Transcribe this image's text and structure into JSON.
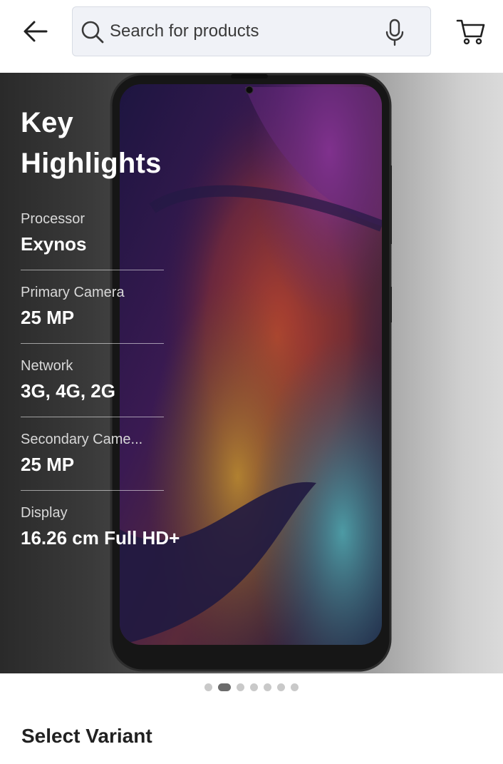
{
  "header": {
    "search_placeholder": "Search for products",
    "icons": [
      "back-arrow-icon",
      "search-icon",
      "mic-icon",
      "cart-icon"
    ]
  },
  "hero": {
    "title_line1": "Key",
    "title_line2": "Highlights",
    "highlights": [
      {
        "label": "Processor",
        "value": "Exynos"
      },
      {
        "label": "Primary Camera",
        "value": "25 MP"
      },
      {
        "label": "Network",
        "value": "3G, 4G, 2G"
      },
      {
        "label": "Secondary Came...",
        "value": "25 MP"
      },
      {
        "label": "Display",
        "value": "16.26 cm Full HD+"
      }
    ]
  },
  "carousel": {
    "total_slides": 7,
    "active_index": 1
  },
  "section": {
    "select_variant": "Select Variant"
  },
  "colors": {
    "accent_text": "#212121",
    "search_bg": "#f0f2f7",
    "active_dot": "#6b6b6b",
    "inactive_dot": "#c9c9c9"
  }
}
